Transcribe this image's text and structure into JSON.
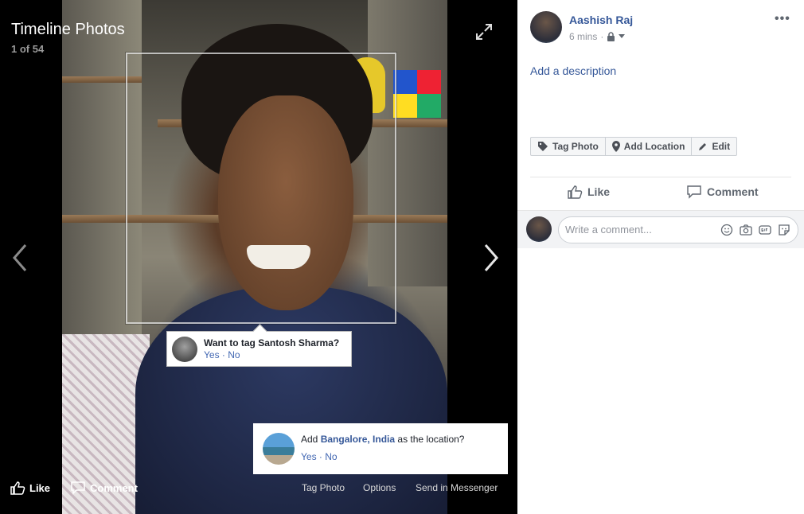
{
  "viewer": {
    "title": "Timeline Photos",
    "counter": "1 of 54",
    "tag_prompt": {
      "question": "Want to tag Santosh Sharma?",
      "yes": "Yes",
      "separator": "·",
      "no": "No"
    },
    "location_prompt": {
      "prefix": "Add",
      "place": "Bangalore, India",
      "suffix": "as the location?",
      "yes": "Yes",
      "separator": "·",
      "no": "No"
    },
    "bottom_bar": {
      "like": "Like",
      "comment": "Comment",
      "tag_photo": "Tag Photo",
      "options": "Options",
      "send_in_messenger": "Send in Messenger"
    }
  },
  "sidebar": {
    "author": "Aashish Raj",
    "time": "6 mins",
    "meta_separator": "·",
    "privacy_icon": "lock-icon",
    "add_description": "Add a description",
    "actions": {
      "tag_photo": "Tag Photo",
      "add_location": "Add Location",
      "edit": "Edit"
    },
    "like": "Like",
    "comment": "Comment",
    "comment_placeholder": "Write a comment..."
  },
  "colors": {
    "link_blue": "#365899",
    "action_blue": "#4267b2",
    "muted_gray": "#90949c",
    "viewer_bg": "#000000"
  }
}
